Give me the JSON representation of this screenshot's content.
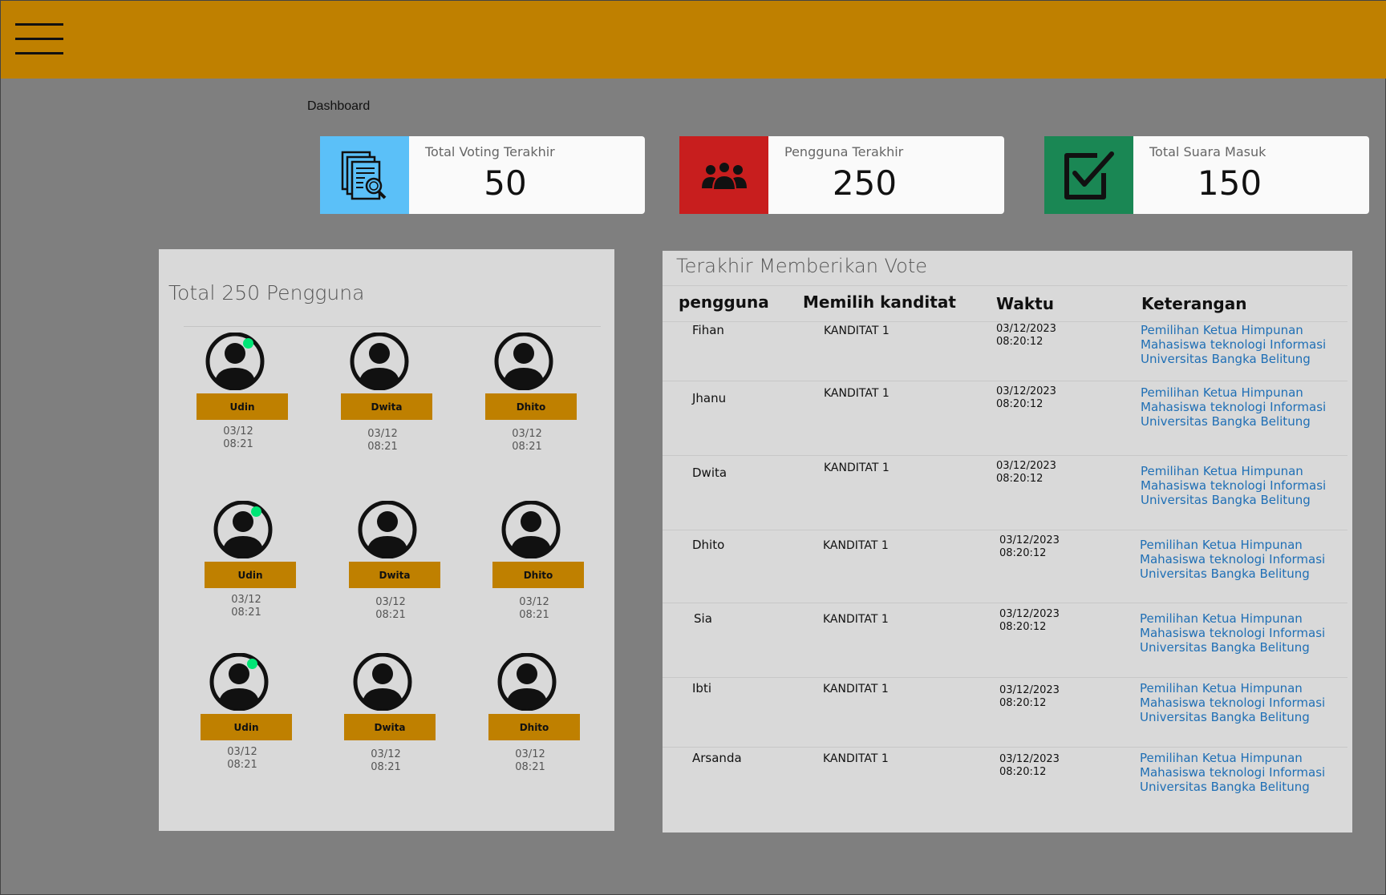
{
  "header": {
    "menu_icon": "hamburger-menu-icon",
    "color": "#bf8000"
  },
  "breadcrumb": "Dashboard",
  "stats": [
    {
      "label": "Total Voting Terakhir",
      "value": "50",
      "icon": "document-search-icon",
      "color": "#5bc0f8"
    },
    {
      "label": "Pengguna Terakhir",
      "value": "250",
      "icon": "users-group-icon",
      "color": "#c81e1e"
    },
    {
      "label": "Total Suara Masuk",
      "value": "150",
      "icon": "checkbox-checked-icon",
      "color": "#1a8754"
    }
  ],
  "users_panel": {
    "title": "Total 250 Pengguna",
    "users": [
      {
        "name": "Udin",
        "date": "03/12",
        "time": "08:21",
        "online": true
      },
      {
        "name": "Dwita",
        "date": "03/12",
        "time": "08:21",
        "online": false
      },
      {
        "name": "Dhito",
        "date": "03/12",
        "time": "08:21",
        "online": false
      },
      {
        "name": "Udin",
        "date": "03/12",
        "time": "08:21",
        "online": true
      },
      {
        "name": "Dwita",
        "date": "03/12",
        "time": "08:21",
        "online": false
      },
      {
        "name": "Dhito",
        "date": "03/12",
        "time": "08:21",
        "online": false
      },
      {
        "name": "Udin",
        "date": "03/12",
        "time": "08:21",
        "online": true
      },
      {
        "name": "Dwita",
        "date": "03/12",
        "time": "08:21",
        "online": false
      },
      {
        "name": "Dhito",
        "date": "03/12",
        "time": "08:21",
        "online": false
      }
    ]
  },
  "votes_panel": {
    "title": "Terakhir Memberikan Vote",
    "headers": [
      "pengguna",
      "Memilih kanditat",
      "Waktu",
      "Keterangan"
    ],
    "rows": [
      {
        "user": "Fihan",
        "candidate": "KANDITAT 1",
        "date": "03/12/2023",
        "time": "08:20:12",
        "desc": "Pemilihan Ketua Himpunan Mahasiswa teknologi Informasi Universitas Bangka Belitung"
      },
      {
        "user": "Jhanu",
        "candidate": "KANDITAT 1",
        "date": "03/12/2023",
        "time": "08:20:12",
        "desc": "Pemilihan Ketua Himpunan Mahasiswa teknologi Informasi Universitas Bangka Belitung"
      },
      {
        "user": "Dwita",
        "candidate": "KANDITAT 1",
        "date": "03/12/2023",
        "time": "08:20:12",
        "desc": "Pemilihan Ketua Himpunan Mahasiswa teknologi Informasi Universitas Bangka Belitung"
      },
      {
        "user": "Dhito",
        "candidate": "KANDITAT 1",
        "date": "03/12/2023",
        "time": "08:20:12",
        "desc": "Pemilihan Ketua Himpunan Mahasiswa teknologi Informasi Universitas Bangka Belitung"
      },
      {
        "user": "Sia",
        "candidate": "KANDITAT 1",
        "date": "03/12/2023",
        "time": "08:20:12",
        "desc": "Pemilihan Ketua Himpunan Mahasiswa teknologi Informasi Universitas Bangka Belitung"
      },
      {
        "user": "Ibti",
        "candidate": "KANDITAT 1",
        "date": "03/12/2023",
        "time": "08:20:12",
        "desc": "Pemilihan Ketua Himpunan Mahasiswa teknologi Informasi Universitas Bangka Belitung"
      },
      {
        "user": "Arsanda",
        "candidate": "KANDITAT 1",
        "date": "03/12/2023",
        "time": "08:20:12",
        "desc": "Pemilihan Ketua Himpunan Mahasiswa teknologi Informasi Universitas Bangka Belitung"
      }
    ]
  }
}
